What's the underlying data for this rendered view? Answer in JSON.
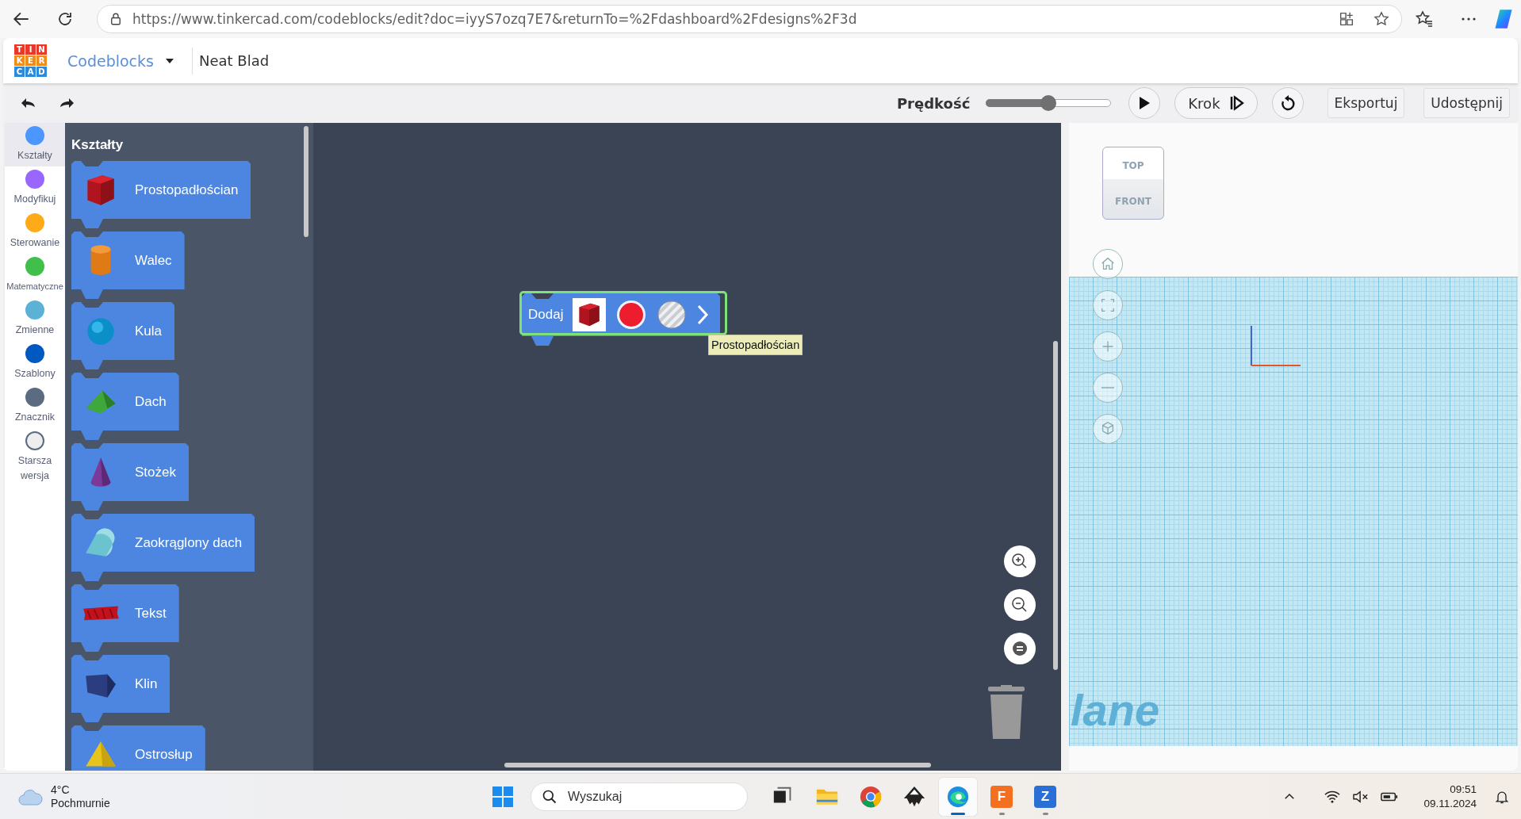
{
  "browser": {
    "url": "https://www.tinkercad.com/codeblocks/edit?doc=iyyS7ozq7E7&returnTo=%2Fdashboard%2Fdesigns%2F3d"
  },
  "app_header": {
    "logo_letters": [
      "T",
      "I",
      "N",
      "K",
      "E",
      "R",
      "C",
      "A",
      "D"
    ],
    "mode_menu": "Codeblocks",
    "design_name": "Neat Blad"
  },
  "toolbar": {
    "speed_label": "Prędkość",
    "speed": {
      "level": 0.5
    },
    "step_button": "Krok",
    "export_button": "Eksportuj",
    "share_button": "Udostępnij"
  },
  "categories": [
    {
      "label": "Kształty",
      "color": "#4c97ff",
      "selected": true
    },
    {
      "label": "Modyfikuj",
      "color": "#9966ff",
      "selected": false
    },
    {
      "label": "Sterowanie",
      "color": "#ffab19",
      "selected": false
    },
    {
      "label": "Matematyczne",
      "color": "#40bf4a",
      "selected": false
    },
    {
      "label": "Zmienne",
      "color": "#5cb1d6",
      "selected": false
    },
    {
      "label": "Szablony",
      "color": "#0059c1",
      "selected": false
    },
    {
      "label": "Znacznik",
      "color": "#5b6b80",
      "selected": false
    },
    {
      "label": "Starsza wersja",
      "color": "#eeeeee",
      "selected": false
    }
  ],
  "palette": {
    "title": "Kształty",
    "blocks": [
      {
        "label": "Prostopadłościan",
        "kind": "box"
      },
      {
        "label": "Walec",
        "kind": "cylinder"
      },
      {
        "label": "Kula",
        "kind": "sphere"
      },
      {
        "label": "Dach",
        "kind": "roof"
      },
      {
        "label": "Stożek",
        "kind": "cone"
      },
      {
        "label": "Zaokrąglony dach",
        "kind": "round_roof"
      },
      {
        "label": "Tekst",
        "kind": "text"
      },
      {
        "label": "Klin",
        "kind": "wedge"
      },
      {
        "label": "Ostrosłup",
        "kind": "pyramid"
      }
    ]
  },
  "workspace": {
    "block": {
      "label": "Dodaj",
      "kind": "box",
      "color": "#ed1c2e",
      "selected": true
    },
    "tooltip": "Prostopadłościan"
  },
  "viewcube": {
    "top": "TOP",
    "front": "FRONT"
  },
  "workplane": {
    "label": "lane"
  },
  "taskbar": {
    "weather": {
      "temperature": "4°C",
      "condition": "Pochmurnie"
    },
    "search_placeholder": "Wyszukaj",
    "apps": [
      {
        "kind": "taskview",
        "running": false,
        "selected": false
      },
      {
        "kind": "explorer",
        "running": false,
        "selected": false
      },
      {
        "kind": "chrome",
        "running": false,
        "selected": false
      },
      {
        "kind": "inkscape",
        "running": false,
        "selected": false
      },
      {
        "kind": "edge",
        "running": true,
        "selected": true
      },
      {
        "kind": "fusion",
        "letter": "F",
        "running": true,
        "selected": false
      },
      {
        "kind": "zapp",
        "letter": "Z",
        "running": true,
        "selected": false
      }
    ],
    "clock": {
      "time": "09:51",
      "date": "09.11.2024"
    }
  }
}
